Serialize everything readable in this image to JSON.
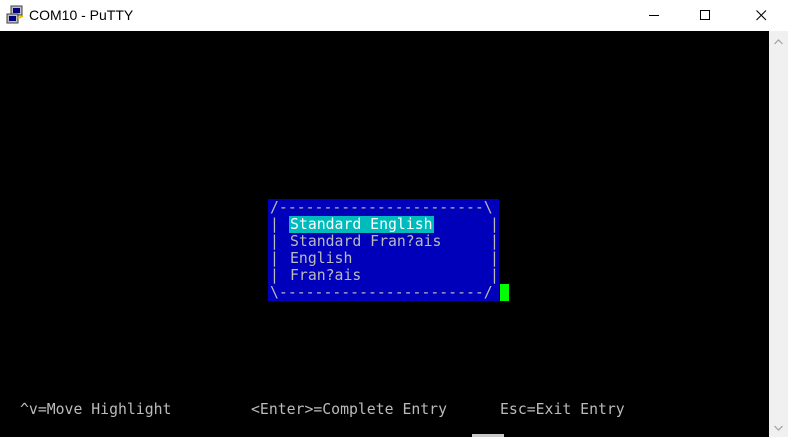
{
  "window": {
    "title": "COM10 - PuTTY",
    "app_icon": "putty-computer-icon",
    "controls": {
      "minimize_icon": "minimize-icon",
      "maximize_icon": "maximize-icon",
      "close_icon": "close-icon"
    }
  },
  "dialog": {
    "border_top": "/-----------------------\\",
    "border_bottom": "\\-----------------------/",
    "side_left": "|",
    "side_right": "|",
    "options": [
      {
        "label": "Standard English",
        "selected": true
      },
      {
        "label": "Standard Fran?ais",
        "selected": false
      },
      {
        "label": "English",
        "selected": false
      },
      {
        "label": "Fran?ais",
        "selected": false
      }
    ]
  },
  "status_bar": {
    "move_hint": "^v=Move Highlight",
    "enter_hint": "<Enter>=Complete Entry",
    "esc_hint": "Esc=Exit Entry"
  },
  "colors": {
    "terminal_bg": "#000000",
    "dialog_bg": "#0000bb",
    "dialog_text": "#bbbbbb",
    "selection_bg": "#00bbbb",
    "selection_text": "#ffffff",
    "cursor": "#00ff00"
  },
  "scrollbar": {
    "up_icon": "scroll-up-arrow-icon",
    "down_icon": "scroll-down-arrow-icon"
  }
}
